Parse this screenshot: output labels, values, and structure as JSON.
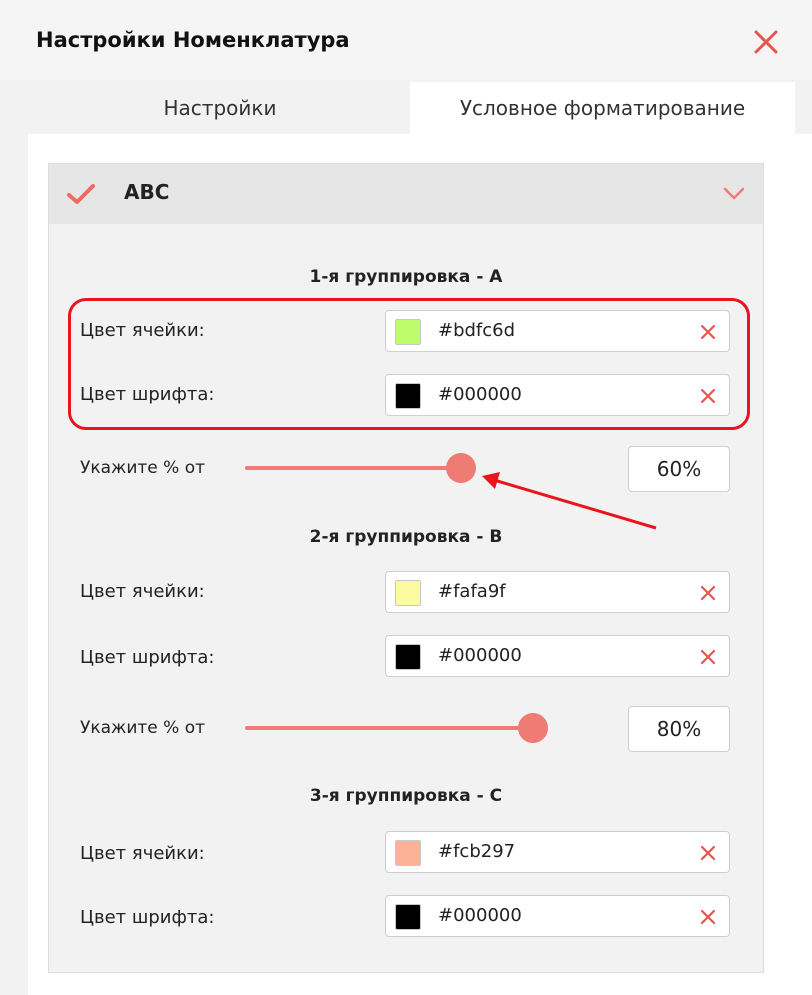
{
  "dialog": {
    "title": "Настройки Номенклатура"
  },
  "tabs": [
    {
      "label": "Настройки",
      "active": false
    },
    {
      "label": "Условное форматирование",
      "active": true
    }
  ],
  "panel": {
    "title": "ABC",
    "checked": true
  },
  "groups": [
    {
      "title": "1-я группировка - A",
      "cell_color_label": "Цвет ячейки:",
      "cell_color": "#bdfc6d",
      "font_color_label": "Цвет шрифта:",
      "font_color": "#000000",
      "percent_label": "Укажите % от",
      "percent": "60%",
      "slider_fraction": 0.6
    },
    {
      "title": "2-я группировка - B",
      "cell_color_label": "Цвет ячейки:",
      "cell_color": "#fafa9f",
      "font_color_label": "Цвет шрифта:",
      "font_color": "#000000",
      "percent_label": "Укажите % от",
      "percent": "80%",
      "slider_fraction": 0.8
    },
    {
      "title": "3-я группировка - C",
      "cell_color_label": "Цвет ячейки:",
      "cell_color": "#fcb297",
      "font_color_label": "Цвет шрифта:",
      "font_color": "#000000"
    }
  ],
  "colors": {
    "accent": "#ee7c74",
    "annotation": "#e8141e",
    "clear_icon": "#e8554f"
  },
  "icons": {
    "close": "close-icon",
    "check": "checkmark-icon",
    "chevron": "chevron-down-icon",
    "clear": "clear-icon"
  }
}
